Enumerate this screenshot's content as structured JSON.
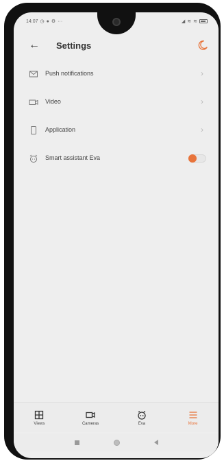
{
  "status_bar": {
    "time": "14:07",
    "left_icons": [
      "whatsapp-icon",
      "notification-dot-icon",
      "settings-gear-icon",
      "more-dots-icon"
    ],
    "right_icons": [
      "signal-icon",
      "wifi-icon",
      "wifi-icon",
      "battery-icon"
    ]
  },
  "header": {
    "title": "Settings",
    "back_icon": "arrow-left-icon",
    "theme_icon": "moon-icon"
  },
  "settings": {
    "items": [
      {
        "label": "Push notifications",
        "icon": "mail-icon",
        "control": "chevron"
      },
      {
        "label": "Video",
        "icon": "video-icon",
        "control": "chevron"
      },
      {
        "label": "Application",
        "icon": "phone-icon",
        "control": "chevron"
      },
      {
        "label": "Smart assistant Eva",
        "icon": "alarm-clock-icon",
        "control": "toggle",
        "enabled": true
      }
    ]
  },
  "bottom_nav": {
    "items": [
      {
        "label": "Views",
        "icon": "grid-icon",
        "active": false
      },
      {
        "label": "Cameras",
        "icon": "camera-icon",
        "active": false
      },
      {
        "label": "Eva",
        "icon": "eva-robot-icon",
        "active": false
      },
      {
        "label": "More",
        "icon": "menu-icon",
        "active": true
      }
    ]
  },
  "colors": {
    "accent": "#e8743b",
    "background": "#eeeeee",
    "text": "#333333"
  }
}
